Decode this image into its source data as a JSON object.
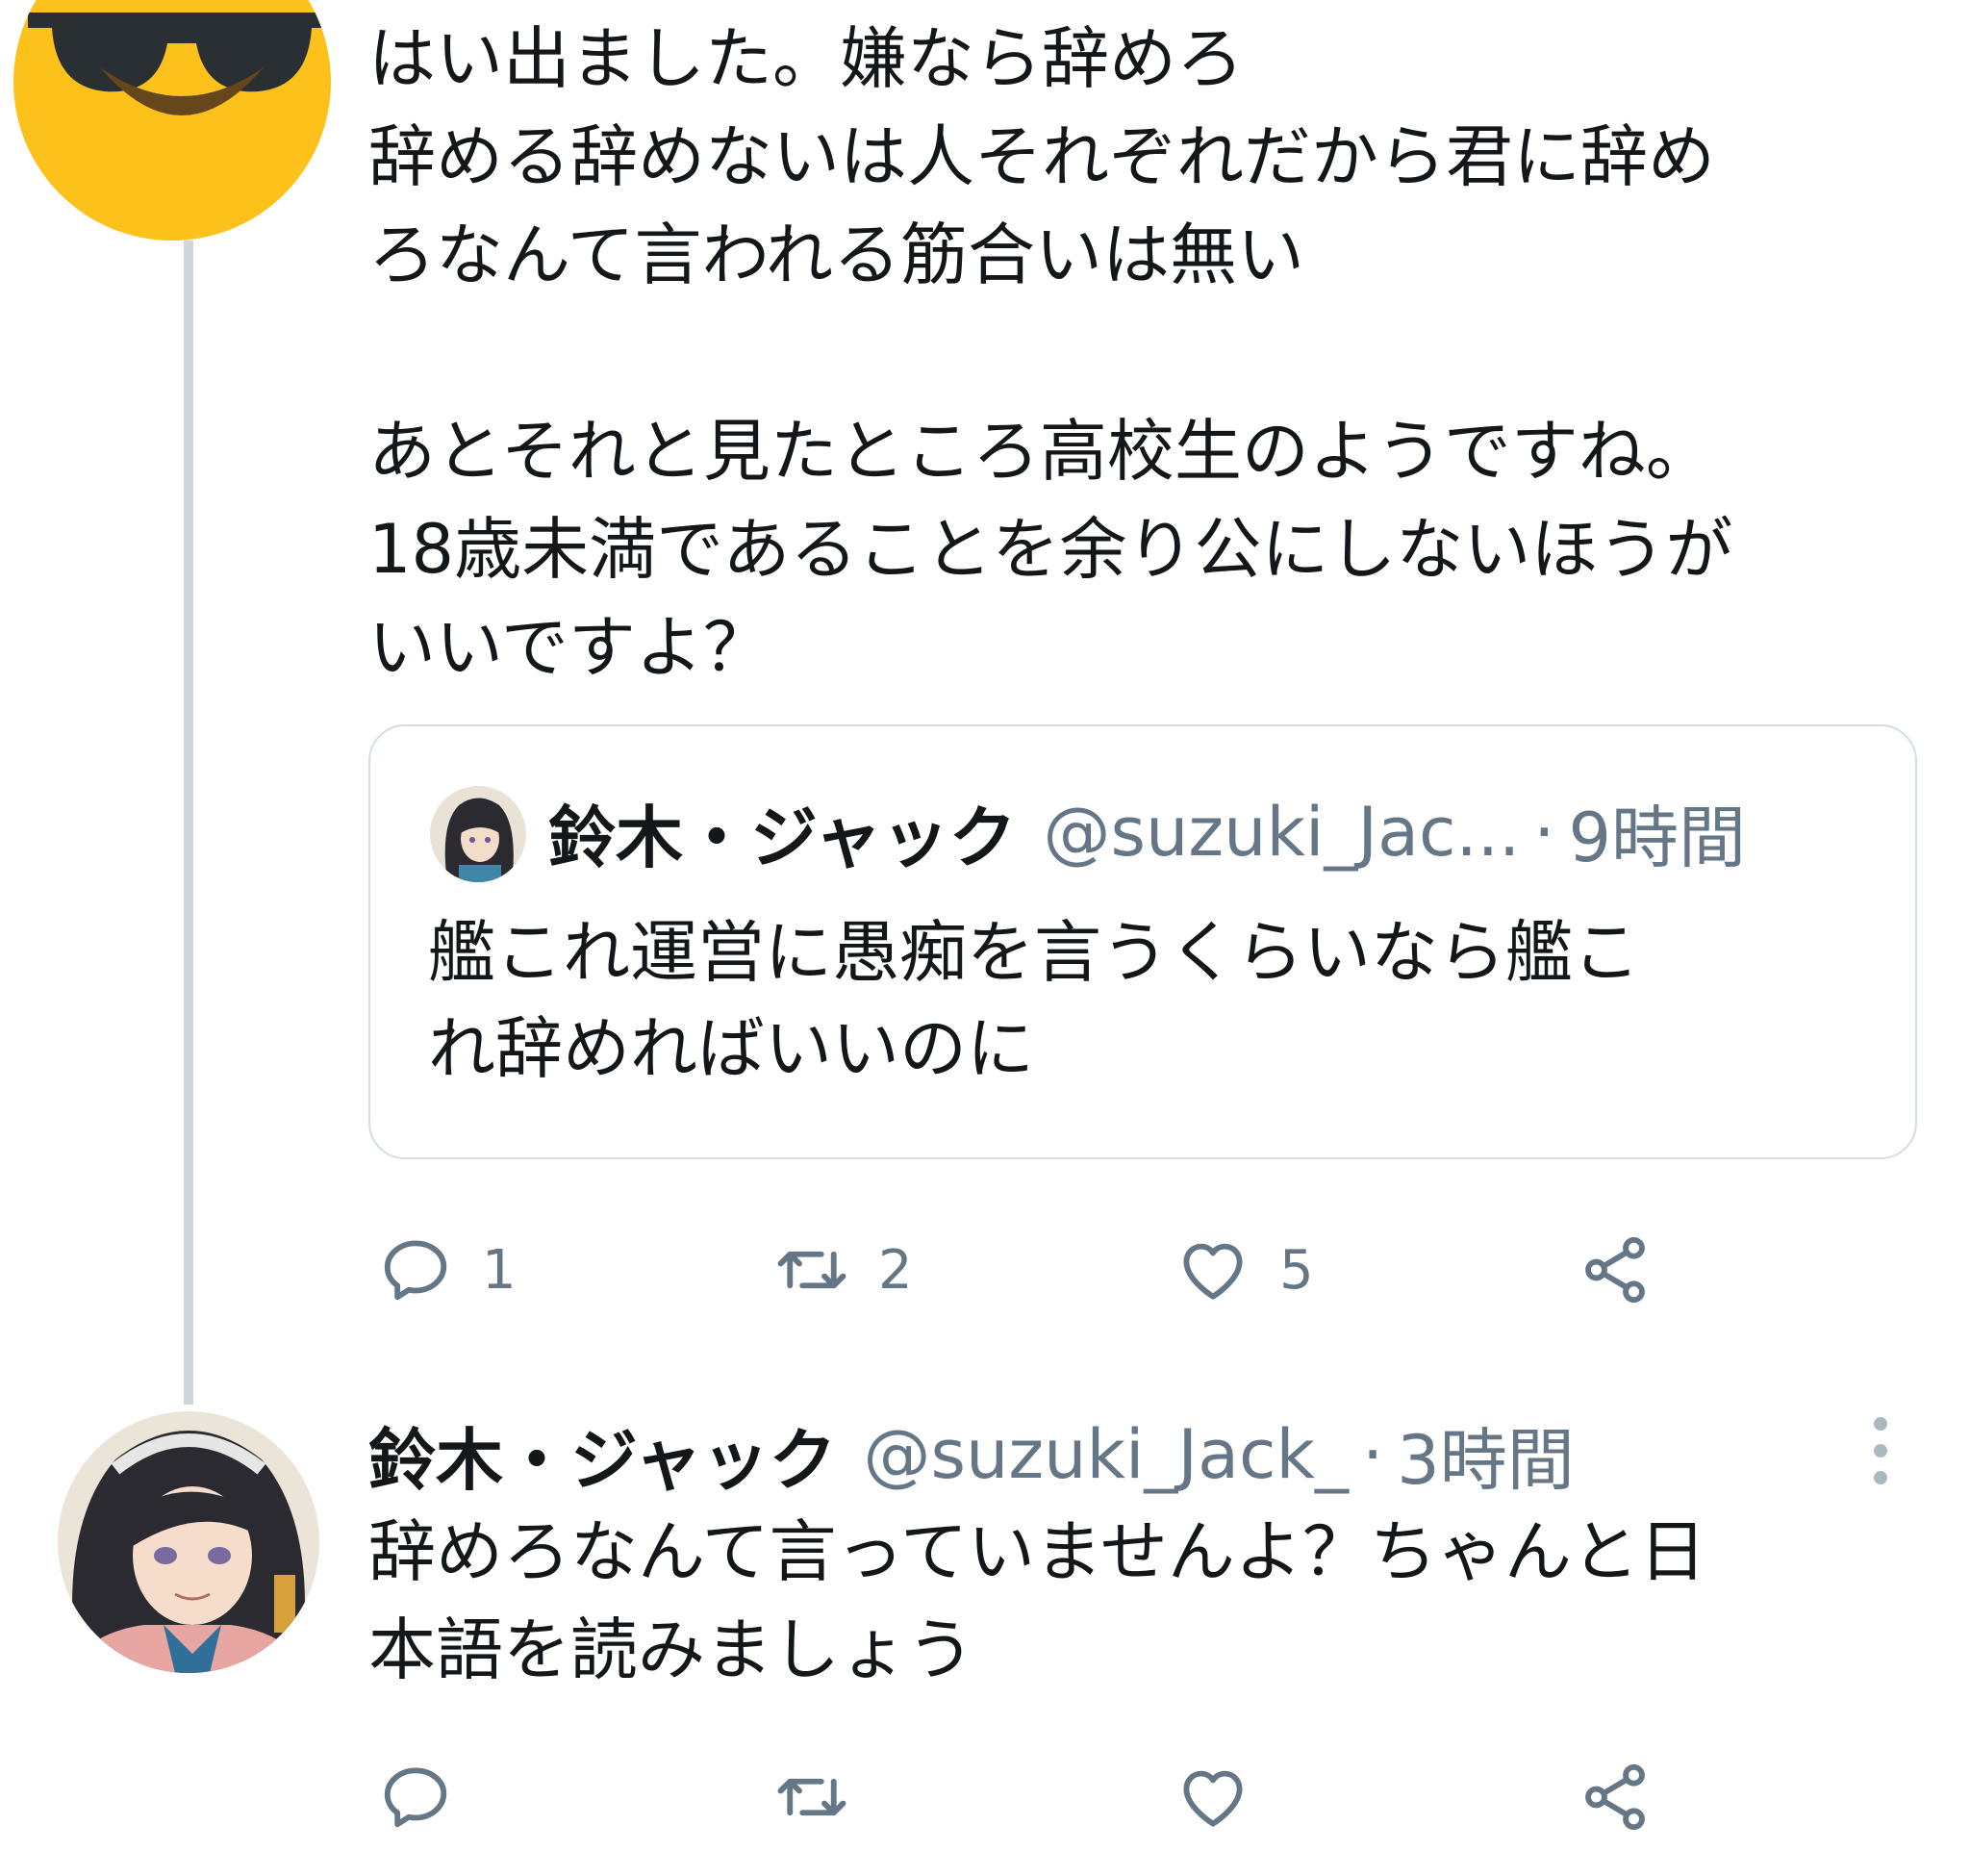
{
  "tweet1": {
    "text": "はい出ました。嫌なら辞めろ\n辞める辞めないは人それぞれだから君に辞め\nろなんて言われる筋合いは無い\n\nあとそれと見たところ高校生のようですね。\n18歳未満であることを余り公にしないほうが\nいいですよ？",
    "quote": {
      "name": "鈴木・ジャック",
      "handle": "@suzuki_Jac...",
      "separator": "·",
      "time": "9時間",
      "text": "艦これ運営に愚痴を言うくらいなら艦こ\nれ辞めればいいのに"
    },
    "actions": {
      "reply_count": "1",
      "retweet_count": "2",
      "like_count": "5"
    }
  },
  "tweet2": {
    "name": "鈴木・ジャック",
    "handle": "@suzuki_Jack_",
    "separator": "·",
    "time": "3時間",
    "text": "辞めろなんて言っていませんよ？ちゃんと日\n本語を読みましょう"
  },
  "icons": {
    "avatar1": "sunglasses-emoji-avatar",
    "avatar2": "anime-girl-avatar",
    "reply": "reply-icon",
    "retweet": "retweet-icon",
    "like": "heart-icon",
    "share": "share-icon",
    "more": "more-vertical-icon"
  },
  "colors": {
    "text": "#14171a",
    "secondary": "#657786",
    "thread_line": "#ccd6dd",
    "border": "#d4dde3"
  }
}
